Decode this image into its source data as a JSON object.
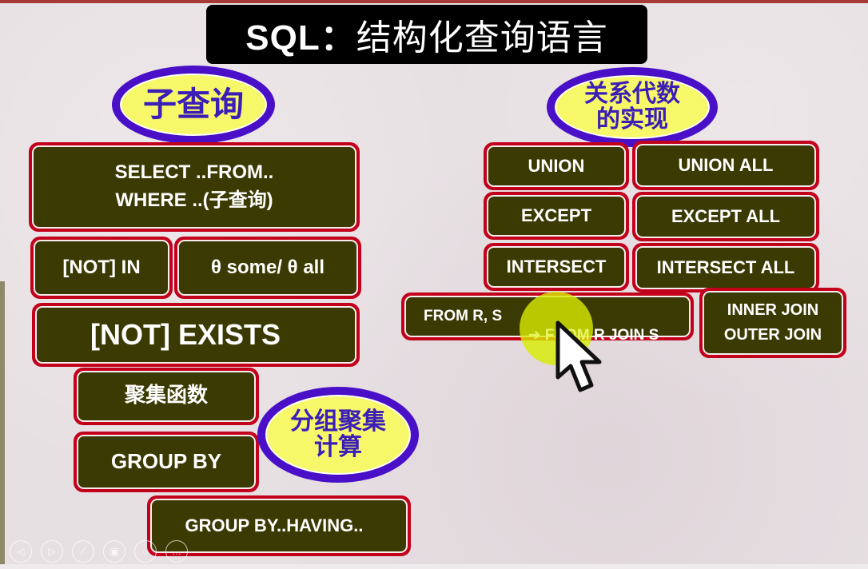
{
  "slide": {
    "title_prefix": "SQL：",
    "title_cn": "结构化查询语言",
    "colors": {
      "box_border": "#c3001b",
      "box_fill": "#3c3a03",
      "oval_border": "#4a10c8",
      "oval_fill": "#f7f76a",
      "oval_text": "#3b1db8",
      "title_bg": "#000000"
    }
  },
  "left": {
    "oval_label": "子查询",
    "select_box": {
      "line1": "SELECT ..FROM..",
      "line2": "WHERE ..(子查询)"
    },
    "not_in": "[NOT] IN",
    "theta": "θ some/ θ all",
    "not_exists": "[NOT] EXISTS",
    "aggregate": "聚集函数",
    "group_by": "GROUP BY",
    "group_oval": {
      "line1": "分组聚集",
      "line2": "计算"
    },
    "group_having": "GROUP BY..HAVING.."
  },
  "right": {
    "oval": {
      "line1": "关系代数",
      "line2": "的实现"
    },
    "set_ops": [
      {
        "left": "UNION",
        "right": "UNION ALL"
      },
      {
        "left": "EXCEPT",
        "right": "EXCEPT ALL"
      },
      {
        "left": "INTERSECT",
        "right": "INTERSECT ALL"
      }
    ],
    "join_box": {
      "from": "FROM R, S",
      "arrow": "➔",
      "to_highlight": "FROM",
      "to_rest": " R JOIN S"
    },
    "join_types": {
      "line1": "INNER JOIN",
      "line2": "OUTER JOIN"
    }
  },
  "player_controls": [
    {
      "icon": "prev-icon",
      "glyph": "◁"
    },
    {
      "icon": "next-icon",
      "glyph": "▷"
    },
    {
      "icon": "pen-icon",
      "glyph": "⁄"
    },
    {
      "icon": "slides-icon",
      "glyph": "▣"
    },
    {
      "icon": "zoom-icon",
      "glyph": "◌"
    },
    {
      "icon": "more-icon",
      "glyph": "…"
    }
  ]
}
